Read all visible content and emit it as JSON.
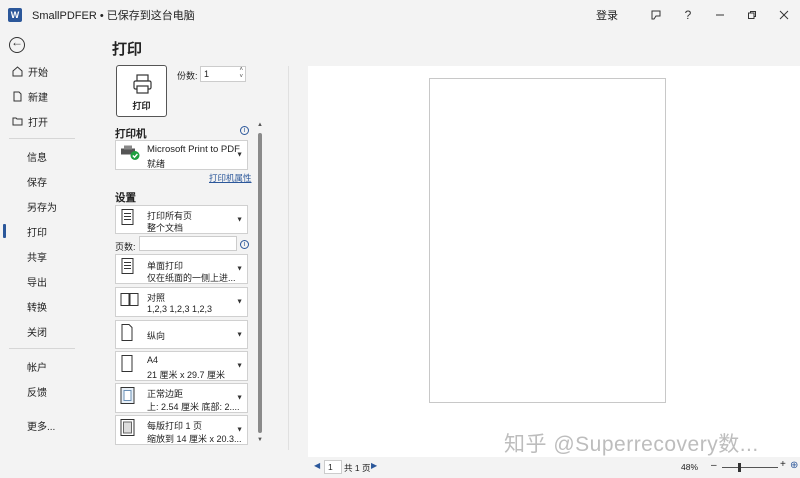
{
  "titlebar": {
    "app_icon": "W",
    "title": "SmallPDFER • 已保存到这台电脑",
    "login": "登录",
    "help": "?",
    "coauthor_icon": "coauthor-icon",
    "min_icon": "minimize-icon",
    "restore_icon": "restore-icon",
    "close_icon": "close-icon"
  },
  "sidebar": {
    "items": [
      {
        "label": "开始",
        "icon": "home-icon"
      },
      {
        "label": "新建",
        "icon": "new-doc-icon"
      },
      {
        "label": "打开",
        "icon": "open-folder-icon"
      },
      {
        "label": "信息"
      },
      {
        "label": "保存"
      },
      {
        "label": "另存为"
      },
      {
        "label": "打印"
      },
      {
        "label": "共享"
      },
      {
        "label": "导出"
      },
      {
        "label": "转换"
      },
      {
        "label": "关闭"
      },
      {
        "label": "帐户"
      },
      {
        "label": "反馈"
      },
      {
        "label": "更多..."
      }
    ]
  },
  "main": {
    "title": "打印",
    "print_button": "打印",
    "copies_label": "份数:",
    "copies_value": "1",
    "printer_section": "打印机",
    "printer": {
      "name": "Microsoft Print to PDF",
      "status": "就绪"
    },
    "printer_props": "打印机属性",
    "settings_section": "设置",
    "settings": [
      {
        "l1": "打印所有页",
        "l2": "整个文档",
        "icon": "pages-icon"
      },
      {
        "l1": "单面打印",
        "l2": "仅在纸面的一侧上进...",
        "icon": "one-sided-icon"
      },
      {
        "l1": "对照",
        "l2": "1,2,3    1,2,3    1,2,3",
        "icon": "collated-icon"
      },
      {
        "l1": "纵向",
        "l2": "",
        "icon": "portrait-icon"
      },
      {
        "l1": "A4",
        "l2": "21 厘米 x 29.7 厘米",
        "icon": "paper-size-icon"
      },
      {
        "l1": "正常边距",
        "l2": "上: 2.54 厘米 底部: 2....",
        "icon": "margins-icon"
      },
      {
        "l1": "每版打印 1 页",
        "l2": "缩放到 14 厘米 x 20.3...",
        "icon": "pages-per-sheet-icon"
      }
    ],
    "pages_label": "页数:",
    "pages_value": ""
  },
  "preview": {
    "watermark": "知乎 @Superrecovery数..."
  },
  "statusbar": {
    "page_value": "1",
    "total": "共 1 页",
    "zoom": "48%",
    "zoom_percent": 48
  }
}
